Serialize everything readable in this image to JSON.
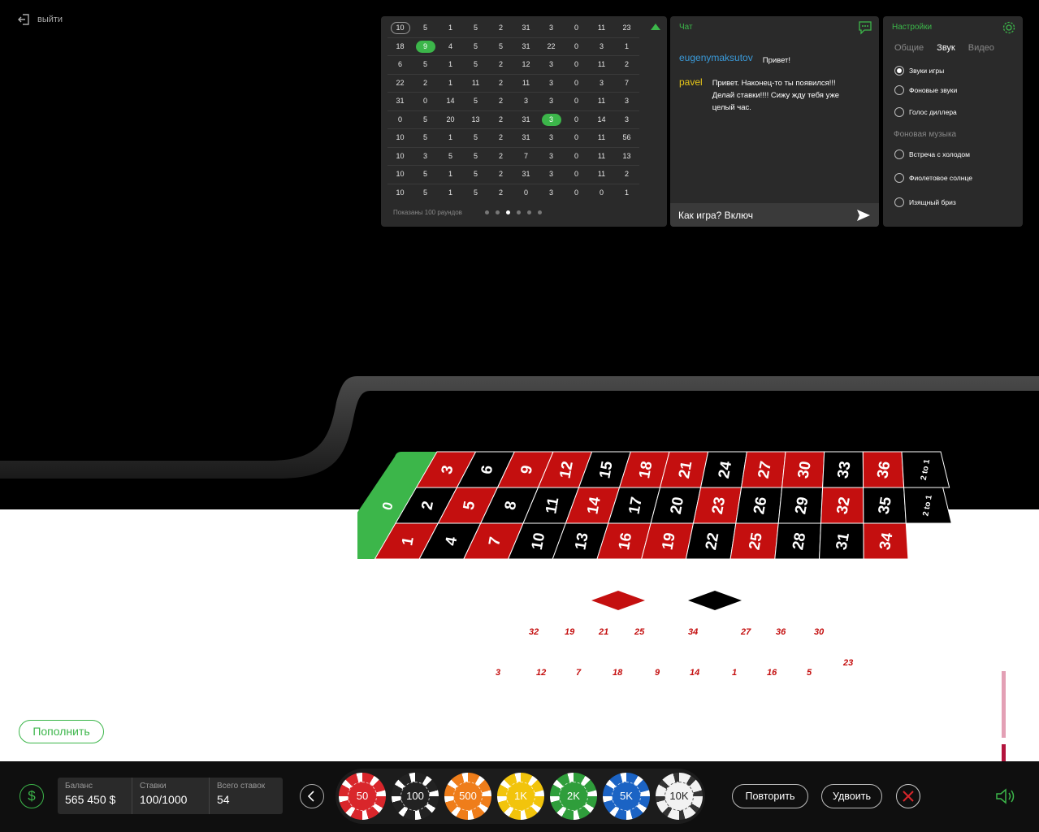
{
  "exit_label": "выйти",
  "history": {
    "rows": [
      [
        "10",
        "5",
        "1",
        "5",
        "2",
        "31",
        "3",
        "0",
        "11",
        "23"
      ],
      [
        "18",
        "9",
        "4",
        "5",
        "5",
        "31",
        "22",
        "0",
        "3",
        "1"
      ],
      [
        "6",
        "5",
        "1",
        "5",
        "2",
        "12",
        "3",
        "0",
        "11",
        "2"
      ],
      [
        "22",
        "2",
        "1",
        "11",
        "2",
        "11",
        "3",
        "0",
        "3",
        "7"
      ],
      [
        "31",
        "0",
        "14",
        "5",
        "2",
        "3",
        "3",
        "0",
        "11",
        "3"
      ],
      [
        "0",
        "5",
        "20",
        "13",
        "2",
        "31",
        "3",
        "0",
        "14",
        "3"
      ],
      [
        "10",
        "5",
        "1",
        "5",
        "2",
        "31",
        "3",
        "0",
        "11",
        "56"
      ],
      [
        "10",
        "3",
        "5",
        "5",
        "2",
        "7",
        "3",
        "0",
        "11",
        "13"
      ],
      [
        "10",
        "5",
        "1",
        "5",
        "2",
        "31",
        "3",
        "0",
        "11",
        "2"
      ],
      [
        "10",
        "5",
        "1",
        "5",
        "2",
        "0",
        "3",
        "0",
        "0",
        "1"
      ]
    ],
    "footer": "Показаны 100 раундов",
    "pages": 6,
    "current_page": 3
  },
  "chat": {
    "title": "Чат",
    "messages": [
      {
        "user": "eugenymaksutov",
        "user_color": "#3a9ad9",
        "text": "Привет!"
      },
      {
        "user": "pavel",
        "user_color": "#e6c619",
        "text": "Привет. Наконец-то ты появился!!! Делай ставки!!!! Сижу жду тебя уже целый час."
      }
    ],
    "input_value": "Как игра? Включ"
  },
  "settings": {
    "title": "Настройки",
    "tabs": [
      "Общие",
      "Звук",
      "Видео"
    ],
    "active_tab": "Звук",
    "options": [
      {
        "label": "Звуки игры",
        "checked": true
      },
      {
        "label": "Фоновые звуки",
        "checked": false
      },
      {
        "label": "Голос диллера",
        "checked": false
      }
    ],
    "music_title": "Фоновая музыка",
    "music": [
      {
        "label": "Встреча с холодом",
        "checked": false
      },
      {
        "label": "Фиолетовое солнце",
        "checked": false
      },
      {
        "label": "Изящный бриз",
        "checked": false
      }
    ]
  },
  "board": {
    "zero": "0",
    "rows": [
      [
        "3",
        "6",
        "9",
        "12",
        "15",
        "18",
        "21",
        "24",
        "27",
        "30",
        "33",
        "36"
      ],
      [
        "2",
        "5",
        "8",
        "11",
        "14",
        "17",
        "20",
        "23",
        "26",
        "29",
        "32",
        "35"
      ],
      [
        "1",
        "4",
        "7",
        "10",
        "13",
        "16",
        "19",
        "22",
        "25",
        "28",
        "31",
        "34"
      ]
    ],
    "red": [
      "1",
      "3",
      "5",
      "7",
      "9",
      "12",
      "14",
      "16",
      "18",
      "19",
      "21",
      "23",
      "25",
      "27",
      "30",
      "32",
      "34",
      "36"
    ],
    "column_bets": [
      "2 to 1",
      "2 to 1"
    ]
  },
  "track_numbers": [
    {
      "n": "32"
    },
    {
      "n": "19"
    },
    {
      "n": "21"
    },
    {
      "n": "25"
    },
    {
      "n": "34"
    },
    {
      "n": "27"
    },
    {
      "n": "36"
    },
    {
      "n": "30"
    },
    {
      "n": "23"
    },
    {
      "n": "3"
    },
    {
      "n": "12"
    },
    {
      "n": "7"
    },
    {
      "n": "18"
    },
    {
      "n": "9"
    },
    {
      "n": "14"
    },
    {
      "n": "1"
    },
    {
      "n": "16"
    },
    {
      "n": "5"
    }
  ],
  "topup_label": "Пополнить",
  "stats": [
    {
      "label": "Баланс",
      "value": "565 450 $"
    },
    {
      "label": "Ставки",
      "value": "100/1000"
    },
    {
      "label": "Всего ставок",
      "value": "54"
    }
  ],
  "chips": [
    {
      "label": "50",
      "color": "#d9262b"
    },
    {
      "label": "100",
      "color": "#222222"
    },
    {
      "label": "500",
      "color": "#ef7d1a"
    },
    {
      "label": "1K",
      "color": "#f2c40c"
    },
    {
      "label": "2K",
      "color": "#2f9e3b"
    },
    {
      "label": "5K",
      "color": "#1b63c4"
    },
    {
      "label": "10K",
      "color": "#f2f2f2"
    }
  ],
  "repeat_label": "Повторить",
  "double_label": "Удвоить",
  "accent": "#3cb64a"
}
